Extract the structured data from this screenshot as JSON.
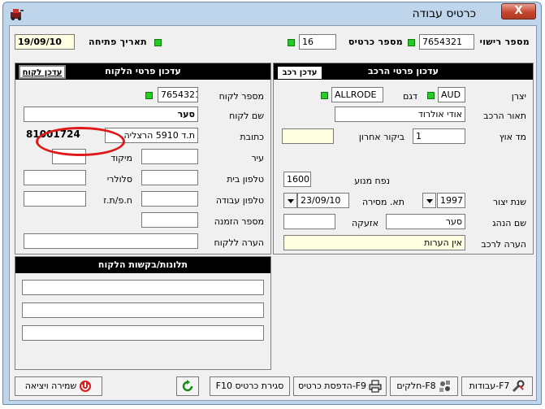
{
  "window": {
    "title": "כרטיס עבודה",
    "close_label": "X"
  },
  "header": {
    "open_date_label": "תאריך פתיחה",
    "open_date_value": "19/09/10",
    "card_number_label": "מספר כרטיס",
    "card_number_value": "16",
    "license_label": "מספר רישוי",
    "license_value": "7654321"
  },
  "vehicle": {
    "panel_title": "עדכון פרטי הרכב",
    "update_button": "עדכן רכב",
    "manufacturer_label": "יצרן",
    "manufacturer_value": "AUD",
    "model_label": "דגם",
    "model_value": "ALLRODE",
    "description_label": "תאור הרכב",
    "description_value": "אודי אולרוד",
    "odometer_label": "מד אוץ",
    "odometer_value": "1",
    "last_visit_label": "ביקור אחרון",
    "last_visit_value": "",
    "engine_label": "נפח מנוע",
    "engine_value": "1600",
    "year_label": "שנת יצור",
    "year_value": "1997",
    "delivery_date_label": "תא. מסירה",
    "delivery_date_value": "23/09/10",
    "driver_label": "שם הנהג",
    "driver_value": "סער",
    "alarm_label": "אזעקה",
    "alarm_value": "",
    "remark_label": "הערה לרכב",
    "remark_value": "אין הערות"
  },
  "customer": {
    "panel_title": "עדכון פרטי הלקוח",
    "update_button": "עדכן לקוח",
    "number_label": "מספר לקוח",
    "number_value": "7654321",
    "name_label": "שם לקוח",
    "name_value": "סער",
    "address_label": "כתובת",
    "address_value": "ת.ד 5910 הרצליה",
    "highlighted_value": "81001724",
    "city_label": "עיר",
    "city_value": "",
    "zip_label": "מיקוד",
    "zip_value": "",
    "home_phone_label": "טלפון בית",
    "home_phone_value": "",
    "cell_label": "סלולרי",
    "cell_value": "",
    "work_phone_label": "טלפון עבודה",
    "work_phone_value": "",
    "id_label": "ח.פ/ת.ז",
    "id_value": "",
    "order_label": "מספר הזמנה",
    "order_value": "",
    "remark_label": "הערה ללקוח",
    "remark_value": ""
  },
  "complaints": {
    "panel_title": "תלונות/בקשות הלקוח",
    "lines": [
      "",
      "",
      ""
    ]
  },
  "toolbar": {
    "jobs": "F7-עבודות",
    "parts": "F8-חלקים",
    "print": "F9-הדפסת כרטיס",
    "close_card": "סגירת כרטיס F10",
    "save_exit": "שמירה ויציאה"
  }
}
